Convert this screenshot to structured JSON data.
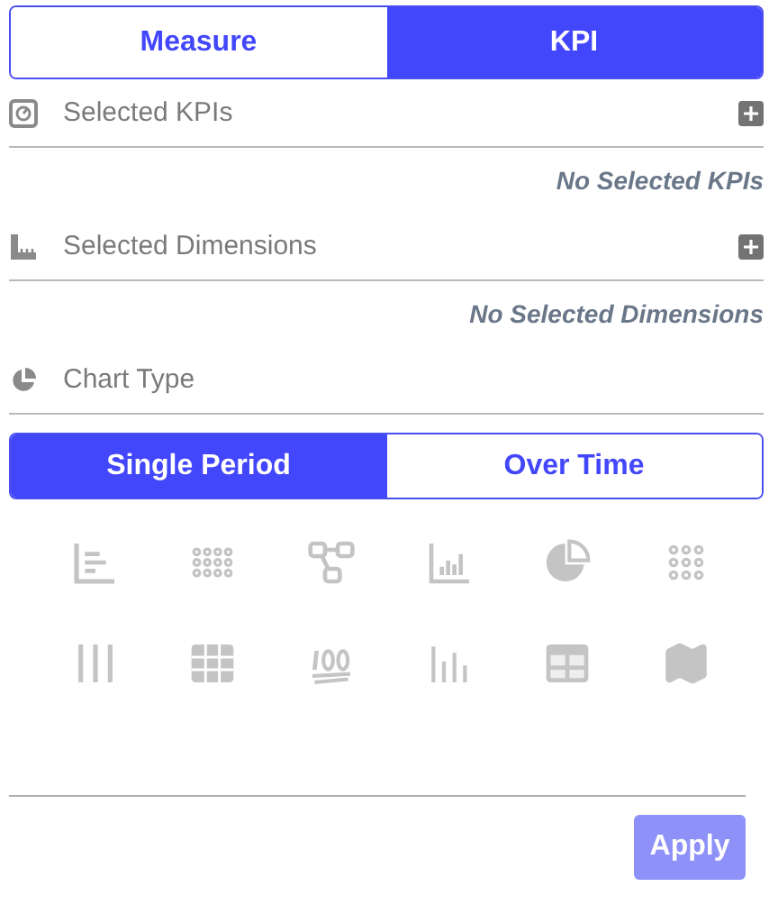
{
  "tabs": [
    {
      "label": "Measure",
      "selected": false
    },
    {
      "label": "KPI",
      "selected": true
    }
  ],
  "sections": [
    {
      "kind": "kpi",
      "label": "Selected KPIs",
      "addable": true,
      "empty_text": "No Selected KPIs"
    },
    {
      "kind": "dimension",
      "label": "Selected Dimensions",
      "addable": true,
      "empty_text": "No Selected Dimensions"
    },
    {
      "kind": "chart",
      "label": "Chart Type",
      "addable": false
    }
  ],
  "period_tabs": [
    {
      "label": "Single Period",
      "selected": true
    },
    {
      "label": "Over Time",
      "selected": false
    }
  ],
  "chart_types": [
    {
      "kind": "bar-horizontal",
      "disabled": true
    },
    {
      "kind": "dots-wide",
      "disabled": true
    },
    {
      "kind": "network",
      "disabled": true
    },
    {
      "kind": "column",
      "disabled": true
    },
    {
      "kind": "pie",
      "disabled": true
    },
    {
      "kind": "dots-square",
      "disabled": true
    },
    {
      "kind": "lines",
      "disabled": true
    },
    {
      "kind": "grid",
      "disabled": true
    },
    {
      "kind": "hundred",
      "disabled": true
    },
    {
      "kind": "thin-bars",
      "disabled": true
    },
    {
      "kind": "table",
      "disabled": true
    },
    {
      "kind": "map",
      "disabled": true
    }
  ],
  "apply": {
    "label": "Apply",
    "disabled": true
  }
}
